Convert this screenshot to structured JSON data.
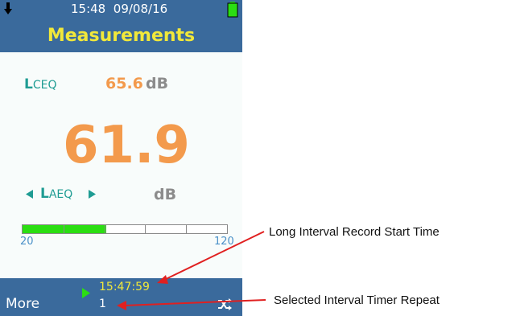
{
  "status_bar": {
    "time": "15:48",
    "date": "09/08/16"
  },
  "header": {
    "title": "Measurements"
  },
  "primary_metric": {
    "label_main": "L",
    "label_sub": "CEQ",
    "value": "65.6",
    "unit": "dB"
  },
  "main_metric": {
    "value": "61.9",
    "label_main": "L",
    "label_sub": "AEQ",
    "unit": "dB"
  },
  "level_bar": {
    "min_label": "20",
    "max_label": "120",
    "fill_fraction": 0.41,
    "segments": 5
  },
  "bottom_bar": {
    "more_label": "More",
    "start_time": "15:47:59",
    "repeat_count": "1"
  },
  "annotations": {
    "start_time_callout": "Long Interval Record Start Time",
    "repeat_callout": "Selected Interval Timer Repeat"
  },
  "colors": {
    "bar_blue": "#3a6a9c",
    "title_yellow": "#f1e83a",
    "teal": "#1f9c93",
    "orange": "#f39a4c",
    "green": "#2bde12",
    "annotation_red": "#e02020"
  },
  "icons": [
    "download-icon",
    "battery-icon",
    "arrow-left-icon",
    "arrow-right-icon",
    "play-icon",
    "shuffle-icon"
  ]
}
